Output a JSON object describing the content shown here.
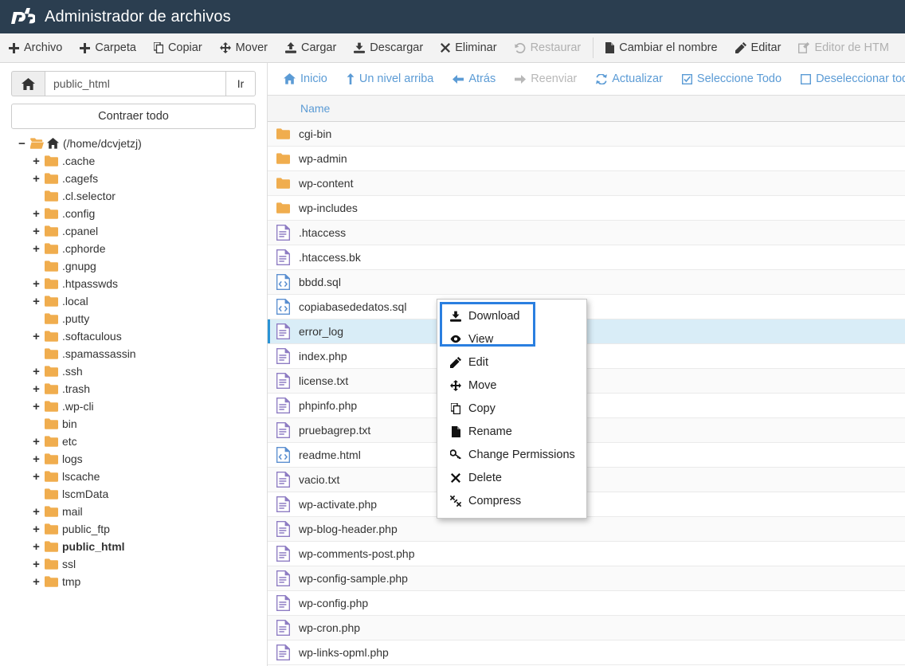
{
  "header": {
    "title": "Administrador de archivos",
    "logo_icon": "cpanel-logo-icon"
  },
  "main_toolbar": {
    "items": [
      {
        "label": "Archivo",
        "icon": "plus-icon",
        "disabled": false,
        "name": "toolbar-new-file"
      },
      {
        "label": "Carpeta",
        "icon": "plus-icon",
        "disabled": false,
        "name": "toolbar-new-folder"
      },
      {
        "label": "Copiar",
        "icon": "copy-icon",
        "disabled": false,
        "name": "toolbar-copy"
      },
      {
        "label": "Mover",
        "icon": "move-icon",
        "disabled": false,
        "name": "toolbar-move"
      },
      {
        "label": "Cargar",
        "icon": "upload-icon",
        "disabled": false,
        "name": "toolbar-upload"
      },
      {
        "label": "Descargar",
        "icon": "download-icon",
        "disabled": false,
        "name": "toolbar-download"
      },
      {
        "label": "Eliminar",
        "icon": "times-icon",
        "disabled": false,
        "name": "toolbar-delete"
      },
      {
        "label": "Restaurar",
        "icon": "undo-icon",
        "disabled": true,
        "name": "toolbar-restore"
      },
      {
        "label": "Cambiar el nombre",
        "icon": "file-icon",
        "disabled": false,
        "name": "toolbar-rename"
      },
      {
        "label": "Editar",
        "icon": "pencil-icon",
        "disabled": false,
        "name": "toolbar-edit"
      },
      {
        "label": "Editor de HTM",
        "icon": "html-edit-icon",
        "disabled": true,
        "name": "toolbar-html-editor"
      }
    ]
  },
  "sidebar": {
    "path_value": "public_html",
    "path_placeholder": "",
    "home_icon": "home-icon",
    "go_label": "Ir",
    "collapse_label": "Contraer todo",
    "tree": [
      {
        "label": "(/home/dcvjetzj)",
        "level": 0,
        "toggle": "−",
        "home": true,
        "current": false
      },
      {
        "label": ".cache",
        "level": 1,
        "toggle": "+",
        "home": false,
        "current": false
      },
      {
        "label": ".cagefs",
        "level": 1,
        "toggle": "+",
        "home": false,
        "current": false
      },
      {
        "label": ".cl.selector",
        "level": 1,
        "toggle": "",
        "home": false,
        "current": false
      },
      {
        "label": ".config",
        "level": 1,
        "toggle": "+",
        "home": false,
        "current": false
      },
      {
        "label": ".cpanel",
        "level": 1,
        "toggle": "+",
        "home": false,
        "current": false
      },
      {
        "label": ".cphorde",
        "level": 1,
        "toggle": "+",
        "home": false,
        "current": false
      },
      {
        "label": ".gnupg",
        "level": 1,
        "toggle": "",
        "home": false,
        "current": false
      },
      {
        "label": ".htpasswds",
        "level": 1,
        "toggle": "+",
        "home": false,
        "current": false
      },
      {
        "label": ".local",
        "level": 1,
        "toggle": "+",
        "home": false,
        "current": false
      },
      {
        "label": ".putty",
        "level": 1,
        "toggle": "",
        "home": false,
        "current": false
      },
      {
        "label": ".softaculous",
        "level": 1,
        "toggle": "+",
        "home": false,
        "current": false
      },
      {
        "label": ".spamassassin",
        "level": 1,
        "toggle": "",
        "home": false,
        "current": false
      },
      {
        "label": ".ssh",
        "level": 1,
        "toggle": "+",
        "home": false,
        "current": false
      },
      {
        "label": ".trash",
        "level": 1,
        "toggle": "+",
        "home": false,
        "current": false
      },
      {
        "label": ".wp-cli",
        "level": 1,
        "toggle": "+",
        "home": false,
        "current": false
      },
      {
        "label": "bin",
        "level": 1,
        "toggle": "",
        "home": false,
        "current": false
      },
      {
        "label": "etc",
        "level": 1,
        "toggle": "+",
        "home": false,
        "current": false
      },
      {
        "label": "logs",
        "level": 1,
        "toggle": "+",
        "home": false,
        "current": false
      },
      {
        "label": "lscache",
        "level": 1,
        "toggle": "+",
        "home": false,
        "current": false
      },
      {
        "label": "lscmData",
        "level": 1,
        "toggle": "",
        "home": false,
        "current": false
      },
      {
        "label": "mail",
        "level": 1,
        "toggle": "+",
        "home": false,
        "current": false
      },
      {
        "label": "public_ftp",
        "level": 1,
        "toggle": "+",
        "home": false,
        "current": false
      },
      {
        "label": "public_html",
        "level": 1,
        "toggle": "+",
        "home": false,
        "current": true
      },
      {
        "label": "ssl",
        "level": 1,
        "toggle": "+",
        "home": false,
        "current": false
      },
      {
        "label": "tmp",
        "level": 1,
        "toggle": "+",
        "home": false,
        "current": false
      }
    ]
  },
  "nav_toolbar": {
    "items": [
      {
        "label": "Inicio",
        "icon": "home-icon",
        "disabled": false,
        "name": "nav-home"
      },
      {
        "label": "Un nivel arriba",
        "icon": "level-up-icon",
        "disabled": false,
        "name": "nav-up-one-level"
      },
      {
        "label": "Atrás",
        "icon": "arrow-left-icon",
        "disabled": false,
        "name": "nav-back"
      },
      {
        "label": "Reenviar",
        "icon": "arrow-right-icon",
        "disabled": true,
        "name": "nav-forward"
      },
      {
        "label": "Actualizar",
        "icon": "refresh-icon",
        "disabled": false,
        "name": "nav-reload"
      },
      {
        "label": "Seleccione Todo",
        "icon": "checkbox-checked-icon",
        "disabled": false,
        "name": "nav-select-all"
      },
      {
        "label": "Deseleccionar todo",
        "icon": "checkbox-empty-icon",
        "disabled": false,
        "name": "nav-deselect-all"
      }
    ]
  },
  "table": {
    "columns": [
      "Name"
    ],
    "rows": [
      {
        "name": "cgi-bin",
        "type": "folder",
        "selected": false
      },
      {
        "name": "wp-admin",
        "type": "folder",
        "selected": false
      },
      {
        "name": "wp-content",
        "type": "folder",
        "selected": false
      },
      {
        "name": "wp-includes",
        "type": "folder",
        "selected": false
      },
      {
        "name": ".htaccess",
        "type": "document",
        "selected": false
      },
      {
        "name": ".htaccess.bk",
        "type": "document",
        "selected": false
      },
      {
        "name": "bbdd.sql",
        "type": "code",
        "selected": false
      },
      {
        "name": "copiabasededatos.sql",
        "type": "code",
        "selected": false
      },
      {
        "name": "error_log",
        "type": "document",
        "selected": true
      },
      {
        "name": "index.php",
        "type": "document",
        "selected": false
      },
      {
        "name": "license.txt",
        "type": "document",
        "selected": false
      },
      {
        "name": "phpinfo.php",
        "type": "document",
        "selected": false
      },
      {
        "name": "pruebagrep.txt",
        "type": "document",
        "selected": false
      },
      {
        "name": "readme.html",
        "type": "code",
        "selected": false
      },
      {
        "name": "vacio.txt",
        "type": "document",
        "selected": false
      },
      {
        "name": "wp-activate.php",
        "type": "document",
        "selected": false
      },
      {
        "name": "wp-blog-header.php",
        "type": "document",
        "selected": false
      },
      {
        "name": "wp-comments-post.php",
        "type": "document",
        "selected": false
      },
      {
        "name": "wp-config-sample.php",
        "type": "document",
        "selected": false
      },
      {
        "name": "wp-config.php",
        "type": "document",
        "selected": false
      },
      {
        "name": "wp-cron.php",
        "type": "document",
        "selected": false
      },
      {
        "name": "wp-links-opml.php",
        "type": "document",
        "selected": false
      }
    ]
  },
  "context_menu": {
    "items": [
      {
        "label": "Download",
        "icon": "download-icon",
        "name": "ctx-download"
      },
      {
        "label": "View",
        "icon": "eye-icon",
        "name": "ctx-view"
      },
      {
        "label": "Edit",
        "icon": "pencil-icon",
        "name": "ctx-edit"
      },
      {
        "label": "Move",
        "icon": "move-icon",
        "name": "ctx-move"
      },
      {
        "label": "Copy",
        "icon": "copy-icon",
        "name": "ctx-copy"
      },
      {
        "label": "Rename",
        "icon": "file-icon",
        "name": "ctx-rename"
      },
      {
        "label": "Change Permissions",
        "icon": "key-icon",
        "name": "ctx-change-permissions"
      },
      {
        "label": "Delete",
        "icon": "times-icon",
        "name": "ctx-delete"
      },
      {
        "label": "Compress",
        "icon": "compress-icon",
        "name": "ctx-compress"
      }
    ]
  },
  "colors": {
    "header_bg": "#2b3e50",
    "folder_icon": "#f0ad4e",
    "document_icon": "#8e7cc3",
    "code_icon": "#5b8fd0",
    "link_blue": "#5b9bd5",
    "selection_bg": "#d9edf7",
    "selection_border": "#2a93d5",
    "focus_outline": "#2a7fe0"
  }
}
